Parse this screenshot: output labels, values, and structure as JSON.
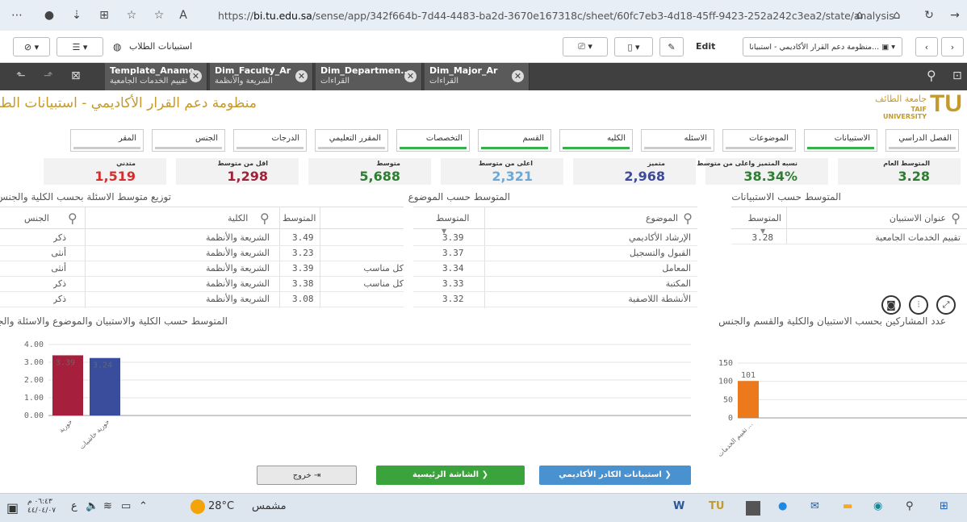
{
  "browser": {
    "url_prefix": "https://",
    "url_host": "bi.tu.edu.sa",
    "url_path": "/sense/app/342f664b-7d44-4483-ba2d-3670e167318c/sheet/60fc7eb3-4d18-45ff-9423-252a242c3ea2/state/analysis"
  },
  "toolbar": {
    "sheet_name": "استبيانات الطلاب",
    "edit_label": "Edit",
    "app_title": "منظومة دعم القرار الأكاديمي - استبيانا..."
  },
  "selections": [
    {
      "field": "Template_Aname",
      "value": "تقييم الخدمات الجامعية"
    },
    {
      "field": "Dim_Faculty_Ar",
      "value": "الشريعة والأنظمة"
    },
    {
      "field": "Dim_Departmen...",
      "value": "القراءات"
    },
    {
      "field": "Dim_Major_Ar",
      "value": "القراءات"
    }
  ],
  "header": {
    "title": "منظومة دعم القرار الأكاديمي - استبيانات الطلاب",
    "logo_ar": "جامعة الطائف",
    "logo_en": "TAIF UNIVERSITY",
    "logo_mark": "TU"
  },
  "filters": [
    {
      "label": "الفصل الدراسي",
      "selected": false
    },
    {
      "label": "الاستبيانات",
      "selected": true
    },
    {
      "label": "الموضوعات",
      "selected": false
    },
    {
      "label": "الاسئله",
      "selected": false
    },
    {
      "label": "الكليه",
      "selected": true
    },
    {
      "label": "القسم",
      "selected": true
    },
    {
      "label": "التخصصات",
      "selected": true
    },
    {
      "label": "المقرر التعليمي",
      "selected": false
    },
    {
      "label": "الدرجات",
      "selected": false
    },
    {
      "label": "الجنس",
      "selected": false
    },
    {
      "label": "المقر",
      "selected": false
    }
  ],
  "kpis": [
    {
      "label": "المتوسط العام",
      "value": "3.28",
      "color": "#2e7d32"
    },
    {
      "label": "نسبه المتميز واعلى من متوسط",
      "value": "38.34%",
      "color": "#2e7d32"
    },
    {
      "label": "متميز",
      "value": "2,968",
      "color": "#3d4a9a"
    },
    {
      "label": "اعلى من متوسط",
      "value": "2,321",
      "color": "#6aa8d8"
    },
    {
      "label": "متوسط",
      "value": "5,688",
      "color": "#2e7d32"
    },
    {
      "label": "اقل من متوسط",
      "value": "1,298",
      "color": "#a0213a"
    },
    {
      "label": "متدني",
      "value": "1,519",
      "color": "#d32f2f"
    }
  ],
  "section_titles": {
    "by_survey": "المتوسط حسب الاستبيانات",
    "by_topic": "المتوسط حسب الموضوع",
    "by_question": "توزيع متوسط الاسئلة بحسب الكلية والجنس",
    "chart_left": "المتوسط حسب الكلية والاستبيان والموضوع والاسئلة والجنس",
    "chart_right": "عدد المشاركين بحسب الاستبيان والكلية والقسم والجنس"
  },
  "table_survey": {
    "col_title": "عنوان الاستبيان",
    "col_avg": "المتوسط",
    "rows": [
      {
        "title": "تقييم الخدمات الجامعية",
        "avg": "3.28"
      }
    ]
  },
  "table_topic": {
    "col_topic": "الموضوع",
    "col_avg": "المتوسط",
    "rows": [
      {
        "topic": "الإرشاد الأكاديمي",
        "avg": "3.39"
      },
      {
        "topic": "القبول والتسجيل",
        "avg": "3.37"
      },
      {
        "topic": "المعامل",
        "avg": "3.34"
      },
      {
        "topic": "المكتبة",
        "avg": "3.33"
      },
      {
        "topic": "الأنشطة اللاصفية",
        "avg": "3.32"
      }
    ]
  },
  "table_question": {
    "col_gender": "الجنس",
    "col_faculty": "الكلية",
    "col_avg": "المتوسط",
    "rows": [
      {
        "gender": "ذكر",
        "faculty": "الشريعة والأنظمة",
        "avg": "3.49",
        "q": ""
      },
      {
        "gender": "أنثى",
        "faculty": "الشريعة والأنظمة",
        "avg": "3.23",
        "q": ""
      },
      {
        "gender": "أنثى",
        "faculty": "الشريعة والأنظمة",
        "avg": "3.39",
        "q": "كل مناسب"
      },
      {
        "gender": "ذكر",
        "faculty": "الشريعة والأنظمة",
        "avg": "3.38",
        "q": "كل مناسب"
      },
      {
        "gender": "ذكر",
        "faculty": "الشريعة والأنظمة",
        "avg": "3.08",
        "q": ""
      }
    ]
  },
  "chart_data": [
    {
      "type": "bar",
      "categories": [
        "حورية",
        "حورية خاشيات"
      ],
      "values": [
        3.39,
        3.24
      ],
      "value_labels": [
        "3.39",
        "3.24"
      ],
      "colors": [
        "#a6203d",
        "#3a4d9c"
      ],
      "yticks": [
        "0.00",
        "1.00",
        "2.00",
        "3.00",
        "4.00"
      ],
      "ylim": [
        0,
        4
      ]
    },
    {
      "type": "bar",
      "categories": [
        "تقييم الخدمات ..."
      ],
      "values": [
        101
      ],
      "value_labels": [
        "101"
      ],
      "colors": [
        "#ec7a1c"
      ],
      "yticks": [
        "0",
        "50",
        "100",
        "150"
      ],
      "ylim": [
        0,
        150
      ]
    }
  ],
  "nav_buttons": {
    "exit": "خروج",
    "home": "الشاشة الرئيسية",
    "academic": "استبيانات الكادر الأكاديمي"
  },
  "taskbar": {
    "weather_temp": "28°C",
    "weather_text": "مشمس",
    "time": "٠٦:٤٣ م",
    "date": "٤٤/٠٤/٠٧",
    "lang": "ع"
  }
}
